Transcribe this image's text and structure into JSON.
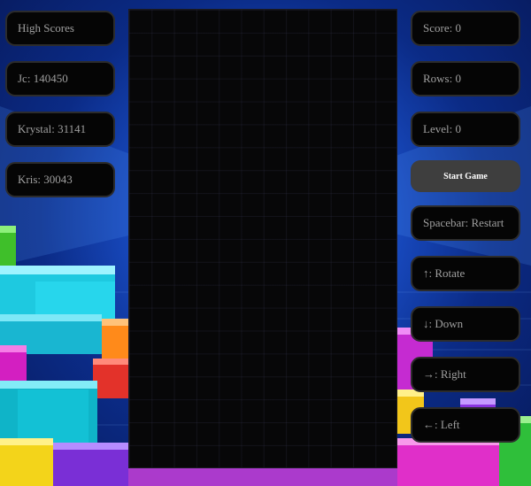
{
  "high_scores": {
    "title": "High Scores",
    "entries": [
      "Jc: 140450",
      "Krystal: 31141",
      "Kris: 30043"
    ]
  },
  "stats": {
    "score": "Score: 0",
    "rows": "Rows: 0",
    "level": "Level: 0"
  },
  "controls": {
    "start_label": "Start Game",
    "restart": "Spacebar: Restart",
    "rotate": "↑: Rotate",
    "down": "↓: Down",
    "right": "→: Right",
    "left": "←: Left"
  },
  "board": {
    "columns": 12,
    "rows": 20
  },
  "colors": {
    "panel_bg": "#050505",
    "panel_border": "#2c2c2c",
    "panel_text": "#9f9f9f",
    "button_bg": "#3e3e3e",
    "board_bg": "#070708"
  }
}
